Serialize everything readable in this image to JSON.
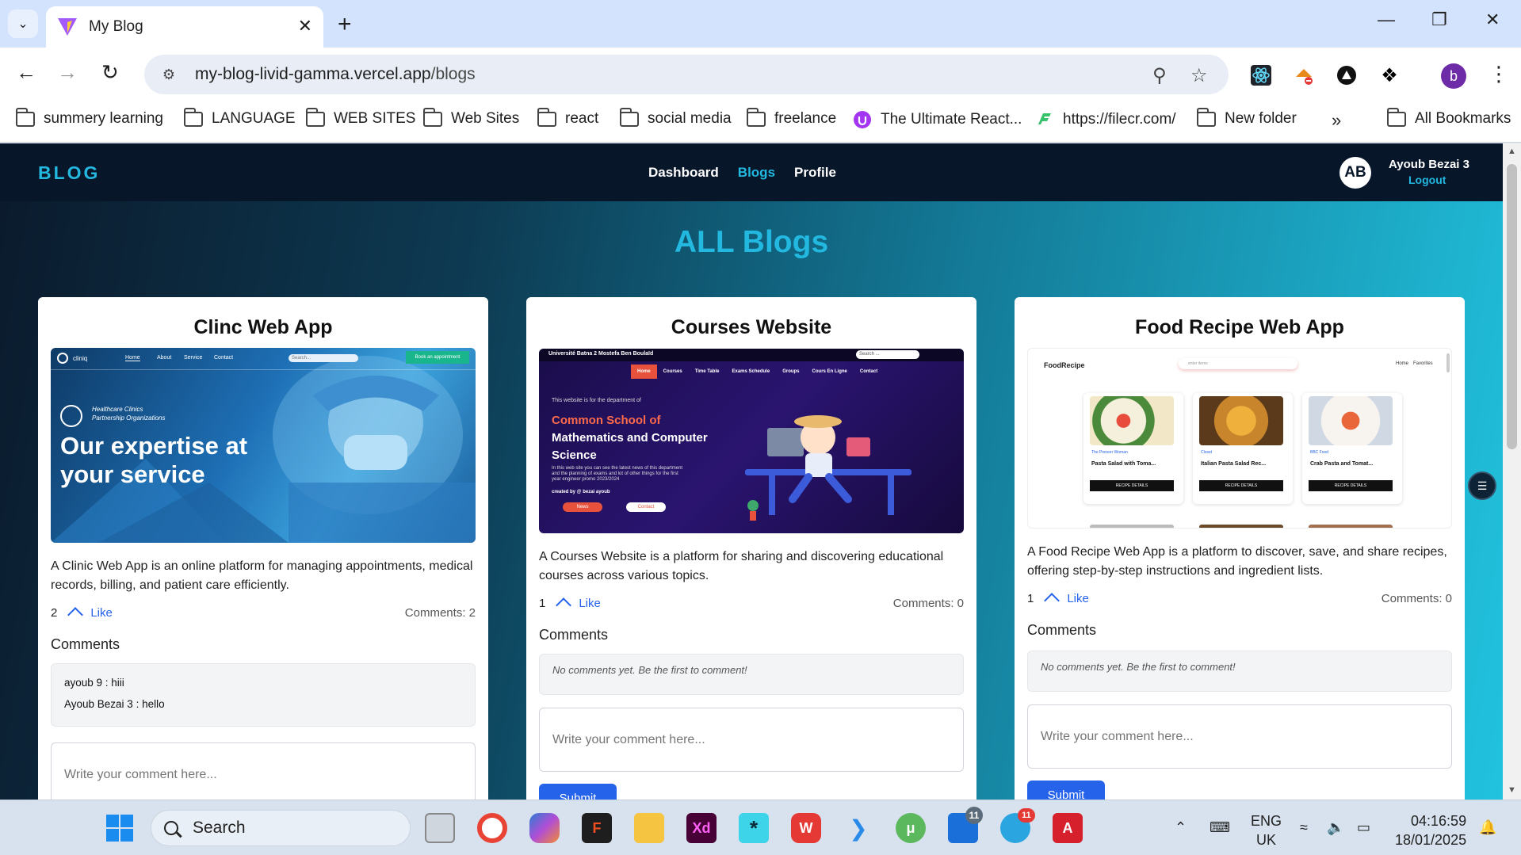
{
  "browser": {
    "tab_title": "My Blog",
    "url_host": "my-blog-livid-gamma.vercel.app",
    "url_path": "/blogs",
    "profile_initial": "b",
    "bookmarks": [
      {
        "label": "summery learning",
        "type": "folder"
      },
      {
        "label": "LANGUAGE",
        "type": "folder"
      },
      {
        "label": "WEB SITES",
        "type": "folder"
      },
      {
        "label": "Web Sites",
        "type": "folder"
      },
      {
        "label": "react",
        "type": "folder"
      },
      {
        "label": "social media",
        "type": "folder"
      },
      {
        "label": "freelance",
        "type": "folder"
      },
      {
        "label": "The Ultimate React...",
        "type": "link"
      },
      {
        "label": "https://filecr.com/",
        "type": "link"
      },
      {
        "label": "New folder",
        "type": "folder"
      }
    ],
    "bookmarks_overflow": "»",
    "all_bookmarks": "All Bookmarks"
  },
  "app": {
    "brand": "BLOG",
    "nav": {
      "dashboard": "Dashboard",
      "blogs": "Blogs",
      "profile": "Profile"
    },
    "user": {
      "initials": "AB",
      "name": "Ayoub Bezai 3",
      "logout": "Logout"
    },
    "page_title": "ALL Blogs"
  },
  "blogs": [
    {
      "title": "Clinc Web App",
      "description": "A Clinic Web App is an online platform for managing appointments, medical records, billing, and patient care efficiently.",
      "likes": "2",
      "like_label": "Like",
      "comments_count": "Comments: 2",
      "comments_heading": "Comments",
      "comments": [
        "ayoub 9 : hiii",
        "Ayoub Bezai 3 : hello"
      ],
      "input_placeholder": "Write your comment here...",
      "thumb": {
        "nav": [
          "Home",
          "About",
          "Service",
          "Contact"
        ],
        "logo": "cliniq",
        "search": "Search...",
        "button": "Book an appointment",
        "org": "Healthcare Clinics\nPartnership Organizations",
        "headline1": "Our expertise at",
        "headline2": "your service"
      }
    },
    {
      "title": "Courses Website",
      "description": "A Courses Website is a platform for sharing and discovering educational courses across various topics.",
      "likes": "1",
      "like_label": "Like",
      "comments_count": "Comments: 0",
      "comments_heading": "Comments",
      "empty_comments": "No comments yet. Be the first to comment!",
      "input_placeholder": "Write your comment here...",
      "submit_label": "Submit",
      "thumb": {
        "uni": "Université Batna 2 Mostefa Ben Boulaïd",
        "search": "Search ...",
        "nav": [
          "Home",
          "Courses",
          "Time Table",
          "Exams Schedule",
          "Groups",
          "Cours En Ligne",
          "Contact"
        ],
        "intro": "This website is for the department of",
        "h1": "Common School of",
        "h2": "Mathematics and Computer",
        "h3": "Science",
        "body": "In this web site you can see the latest news of this department and the planning of exams and lot of other things for the first year engineer promo 2023/2024",
        "credit": "created by @ bezai ayoub",
        "btn1": "News",
        "btn2": "Contact"
      }
    },
    {
      "title": "Food Recipe Web App",
      "description": "A Food Recipe Web App is a platform to discover, save, and share recipes, offering step-by-step instructions and ingredient lists.",
      "likes": "1",
      "like_label": "Like",
      "comments_count": "Comments: 0",
      "comments_heading": "Comments",
      "empty_comments": "No comments yet. Be the first to comment!",
      "input_placeholder": "Write your comment here...",
      "submit_label": "Submit",
      "thumb": {
        "logo": "FoodRecipe",
        "search": "enter items",
        "nav": [
          "Home",
          "Favorites"
        ],
        "recipes": [
          {
            "source": "The Pioneer Woman",
            "name": "Pasta Salad with Toma...",
            "btn": "RECIPE DETAILS"
          },
          {
            "source": "Closet",
            "name": "Italian Pasta Salad Rec...",
            "btn": "RECIPE DETAILS"
          },
          {
            "source": "BBC Food",
            "name": "Crab Pasta and Tomat...",
            "btn": "RECIPE DETAILS"
          }
        ]
      }
    }
  ],
  "taskbar": {
    "search": "Search",
    "lang1": "ENG",
    "lang2": "UK",
    "time": "04:16:59",
    "date": "18/01/2025",
    "badge_outlook": "11",
    "badge_telegram": "11"
  }
}
